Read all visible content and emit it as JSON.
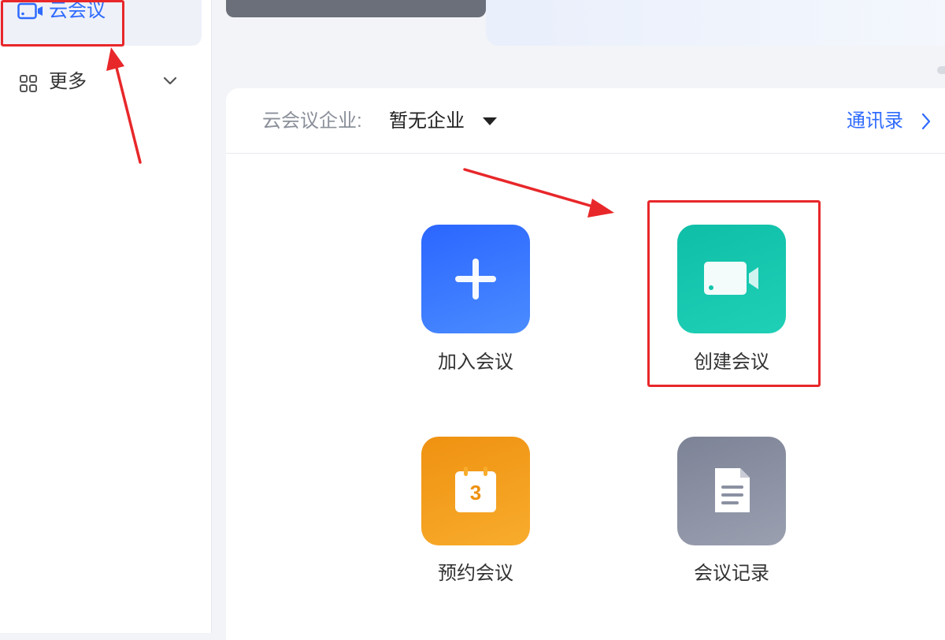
{
  "sidebar": {
    "items": [
      {
        "label": "云会议",
        "icon": "video-camera-icon",
        "active": true
      },
      {
        "label": "更多",
        "icon": "grid-icon",
        "expandable": true
      }
    ]
  },
  "header": {
    "enterprise_label": "云会议企业:",
    "enterprise_value": "暂无企业",
    "contacts_label": "通讯录"
  },
  "actions": [
    {
      "label": "加入会议",
      "icon": "plus-icon",
      "color": "#2f6bff"
    },
    {
      "label": "创建会议",
      "icon": "video-camera-icon",
      "color": "#14c4ab"
    },
    {
      "label": "预约会议",
      "icon": "calendar-icon",
      "color": "#f39a1a",
      "calendar_day": "3"
    },
    {
      "label": "会议记录",
      "icon": "document-icon",
      "color": "#858b9c"
    }
  ],
  "colors": {
    "accent": "#2f6bff",
    "annotation": "#e8272a"
  }
}
